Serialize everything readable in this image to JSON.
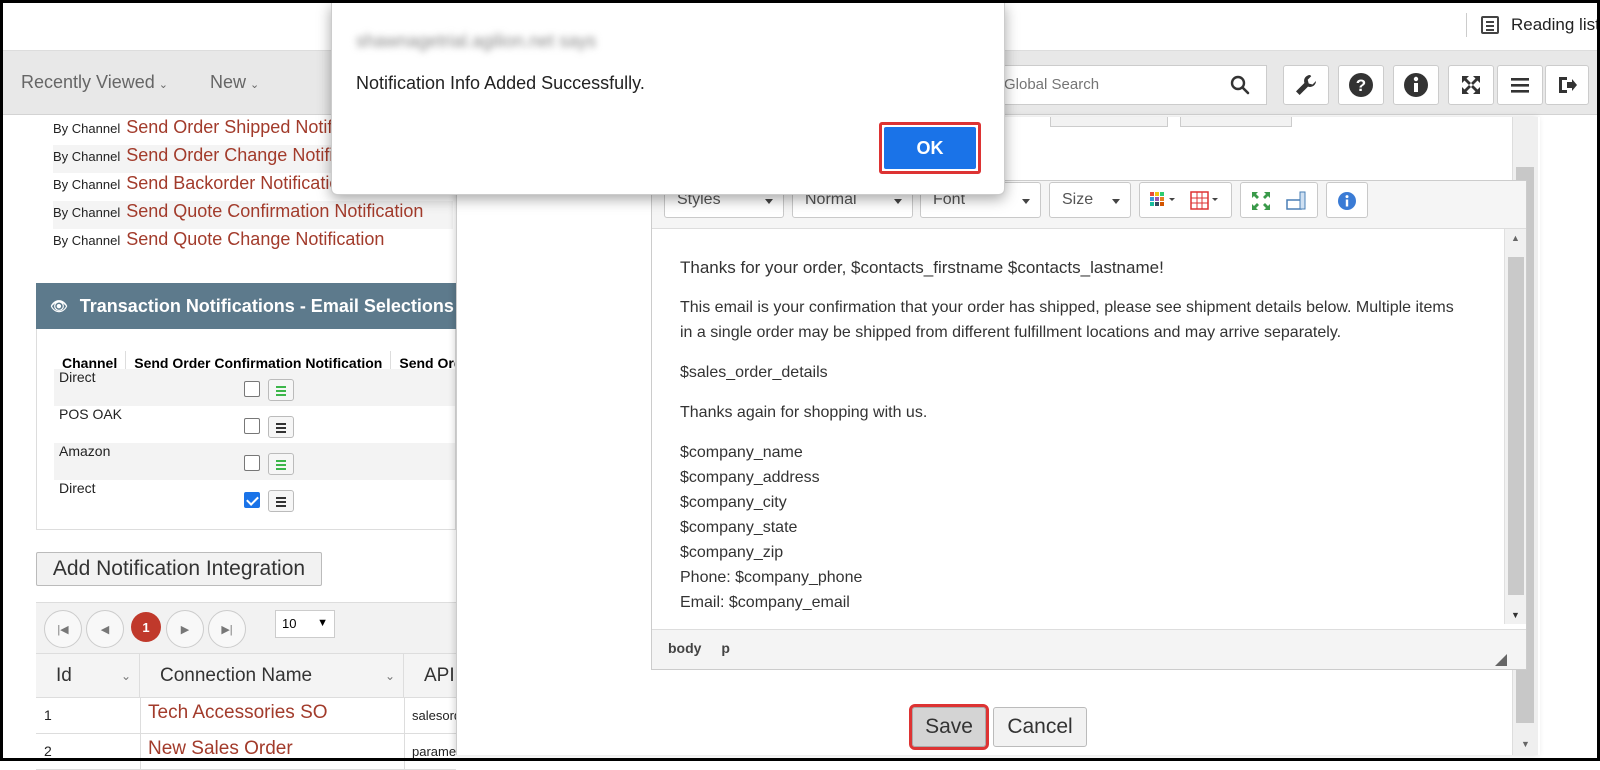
{
  "browser": {
    "blurred_title": "· · · · ·",
    "reading_list_label": "Reading list"
  },
  "nav": {
    "recently_viewed": "Recently Viewed",
    "new": "New",
    "search_placeholder": "Global Search"
  },
  "by_channel": {
    "prefix": "By Channel",
    "items": [
      "Send Order Shipped Notification",
      "Send Order Change Notification",
      "Send Backorder Notification",
      "Send Quote Confirmation Notification",
      "Send Quote Change Notification"
    ]
  },
  "transaction_section": {
    "title": "Transaction Notifications - Email Selections",
    "columns": [
      "Channel",
      "Send Order Confirmation Notification",
      "Send Order Shipped Notification"
    ],
    "rows": [
      {
        "channel": "Direct",
        "checked": false
      },
      {
        "channel": "POS OAK",
        "checked": false
      },
      {
        "channel": "Amazon",
        "checked": false
      },
      {
        "channel": "Direct",
        "checked": true
      }
    ]
  },
  "add_integration_label": "Add Notification Integration",
  "pager": {
    "current_page": "1",
    "page_size": "10"
  },
  "grid": {
    "columns": [
      "Id",
      "Connection Name",
      "API"
    ],
    "rows": [
      {
        "id": "1",
        "name": "Tech Accessories SO",
        "api": "salesorder"
      },
      {
        "id": "2",
        "name": "New Sales Order",
        "api": "parameters"
      }
    ]
  },
  "editor": {
    "styles_label": "Styles",
    "format_label": "Normal",
    "font_label": "Font",
    "size_label": "Size",
    "greeting": "Thanks for your order, $contacts_firstname $contacts_lastname!",
    "paragraph": "This email is your confirmation that your order has shipped, please see shipment details below. Multiple items in a single order may be shipped from different fulfillment locations and may arrive separately.",
    "details_token": "$sales_order_details",
    "thanks_again": "Thanks again for shopping with us.",
    "signature": [
      "$company_name",
      "$company_address",
      "$company_city",
      "$company_state",
      "$company_zip",
      "Phone: $company_phone",
      "Email: $company_email"
    ],
    "status_path": [
      "body",
      "p"
    ]
  },
  "actions": {
    "save": "Save",
    "cancel": "Cancel"
  },
  "alert": {
    "origin": "shawnagetrial.agilion.net says",
    "message": "Notification Info Added Successfully.",
    "ok": "OK"
  },
  "colors": {
    "link": "#a23b2b",
    "section_header": "#5d7a8c",
    "primary": "#1a73e8",
    "highlight": "#dd3333"
  }
}
